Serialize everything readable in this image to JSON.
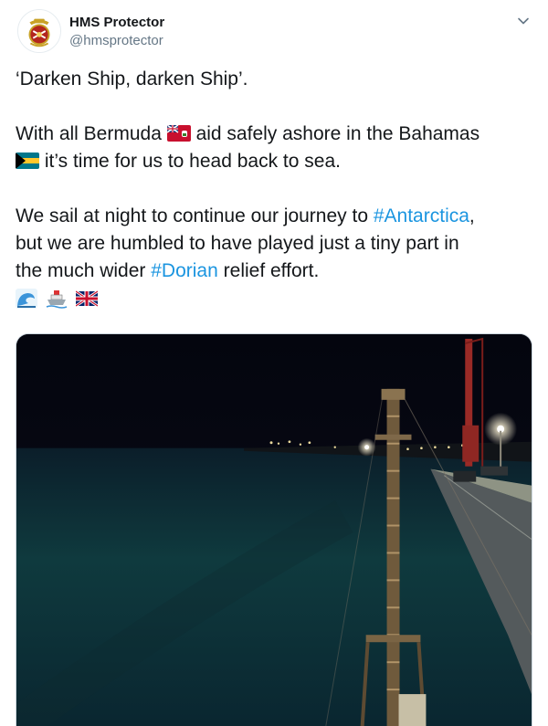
{
  "tweet": {
    "author_name": "HMS Protector",
    "author_handle": "@hmsprotector",
    "text": {
      "line1": "‘Darken Ship, darken Ship’.",
      "line2_a": "With all Bermuda",
      "line2_b": "aid safely ashore in the Bahamas",
      "line3": "it’s time for us to head back to sea.",
      "line4_a": "We sail at night to continue our journey to",
      "line4_hashtag": "#Antarctica",
      "line4_b": ",",
      "line5": "but we are humbled to have played just a tiny part in",
      "line6_a": "the much wider",
      "line6_hashtag": "#Dorian",
      "line6_b": "relief effort."
    },
    "emojis": [
      "water-wave-icon",
      "ship-icon",
      "uk-flag-icon"
    ],
    "flags": [
      "bermuda-flag-icon",
      "bahamas-flag-icon"
    ],
    "hashtag_color": "#1b95e0",
    "media": {
      "type": "photo",
      "icon": "night-harbour-photo"
    }
  }
}
